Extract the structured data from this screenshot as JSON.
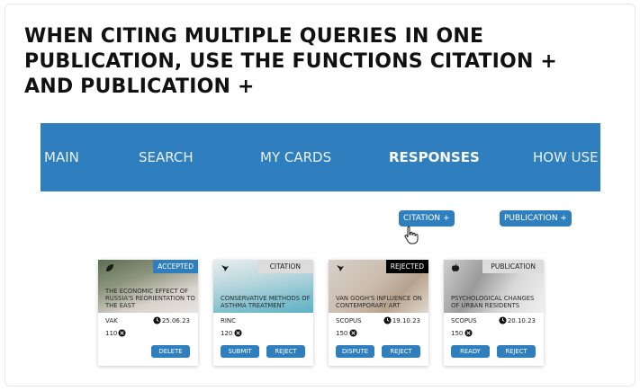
{
  "headline": {
    "line1": "WHEN CITING MULTIPLE QUERIES IN ONE",
    "line2": "PUBLICATION, USE THE FUNCTIONS CITATION +",
    "line3": "AND PUBLICATION +"
  },
  "nav": {
    "items": [
      {
        "label": "MAIN"
      },
      {
        "label": "SEARCH"
      },
      {
        "label": "MY CARDS"
      },
      {
        "label": "RESPONSES",
        "active": true
      },
      {
        "label": "HOW USE"
      }
    ]
  },
  "actions": {
    "citation_plus": "CITATION +",
    "publication_plus": "PUBLICATION +"
  },
  "colors": {
    "accent": "#2f7ebd",
    "accepted_badge": "#2f7ebd",
    "rejected_badge": "#000000",
    "neutral_badge": "#dcdcdc"
  },
  "cards": [
    {
      "status": "ACCEPTED",
      "title": "THE ECONOMIC EFFECT OF RUSSIA'S REORIENTATION TO THE EAST",
      "source": "VAK",
      "date": "25.06.23",
      "count": "110",
      "logo_icon": "leaf-icon",
      "buttons": [
        "DELETE"
      ]
    },
    {
      "status": "CITATION",
      "title": "CONSERVATIVE METHODS OF ASTHMA TREATMENT",
      "source": "RINC",
      "date": "",
      "count": "120",
      "logo_icon": "bird-icon",
      "buttons": [
        "SUBMIT",
        "REJECT"
      ]
    },
    {
      "status": "REJECTED",
      "title": "VAN GOGH'S INFLUENCE ON CONTEMPORARY ART",
      "source": "SCOPUS",
      "date": "19.10.23",
      "count": "150",
      "logo_icon": "bird-icon",
      "buttons": [
        "DISPUTE",
        "REJECT"
      ]
    },
    {
      "status": "PUBLICATION",
      "title": "PSYCHOLOGICAL CHANGES OF URBAN RESIDENTS",
      "source": "SCOPUS",
      "date": "20.10.23",
      "count": "150",
      "logo_icon": "apple-icon",
      "buttons": [
        "READY",
        "REJECT"
      ]
    }
  ]
}
